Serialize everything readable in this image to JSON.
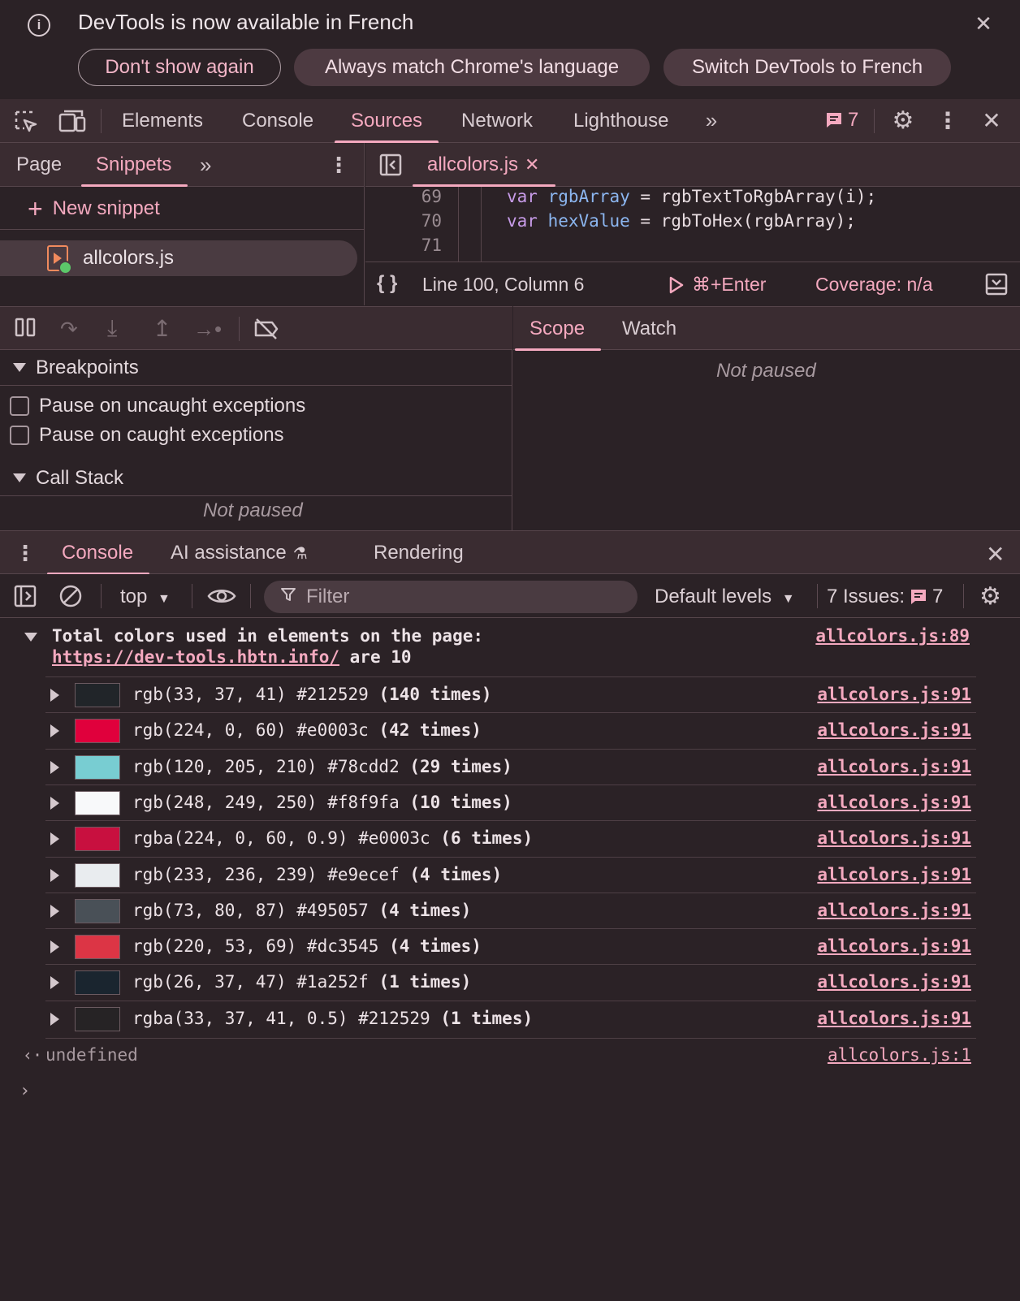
{
  "infobar": {
    "message": "DevTools is now available in French",
    "buttons": [
      "Don't show again",
      "Always match Chrome's language",
      "Switch DevTools to French"
    ]
  },
  "main_tabs": [
    "Elements",
    "Console",
    "Sources",
    "Network",
    "Lighthouse"
  ],
  "active_main_tab": "Sources",
  "issues_badge_count": "7",
  "left_tabs": [
    "Page",
    "Snippets"
  ],
  "active_left_tab": "Snippets",
  "new_snippet_label": "New snippet",
  "snippet_file": "allcolors.js",
  "editor": {
    "tab_name": "allcolors.js",
    "lines": [
      {
        "num": "69",
        "keyword": "var",
        "variable": "rgbArray",
        "rest": " = rgbTextToRgbArray(i);"
      },
      {
        "num": "70",
        "keyword": "var",
        "variable": "hexValue",
        "rest": " = rgbToHex(rgbArray);"
      },
      {
        "num": "71",
        "keyword": "",
        "variable": "",
        "rest": ""
      }
    ],
    "position": "Line 100, Column 6",
    "run_shortcut": "⌘+Enter",
    "coverage": "Coverage: n/a"
  },
  "debugger": {
    "breakpoints_title": "Breakpoints",
    "pause_uncaught": "Pause on uncaught exceptions",
    "pause_caught": "Pause on caught exceptions",
    "callstack_title": "Call Stack",
    "not_paused": "Not paused",
    "scope_tabs": [
      "Scope",
      "Watch"
    ],
    "scope_not_paused": "Not paused"
  },
  "drawer_tabs": [
    "Console",
    "AI assistance",
    "Rendering"
  ],
  "console_toolbar": {
    "context": "top",
    "filter_placeholder": "Filter",
    "levels": "Default levels",
    "issues_label": "7 Issues:",
    "issues_count": "7"
  },
  "console": {
    "group_line1": "Total colors used in elements on the page:",
    "group_url": "https://dev-tools.hbtn.info/",
    "group_suffix": " are 10",
    "group_source": "allcolors.js:89",
    "rows": [
      {
        "color": "#212529",
        "value": "rgb(33, 37, 41) #212529",
        "count": "(140 times)",
        "source": "allcolors.js:91"
      },
      {
        "color": "#e0003c",
        "value": "rgb(224, 0, 60) #e0003c",
        "count": "(42 times)",
        "source": "allcolors.js:91"
      },
      {
        "color": "#78cdd2",
        "value": "rgb(120, 205, 210) #78cdd2",
        "count": "(29 times)",
        "source": "allcolors.js:91"
      },
      {
        "color": "#f8f9fa",
        "value": "rgb(248, 249, 250) #f8f9fa",
        "count": "(10 times)",
        "source": "allcolors.js:91"
      },
      {
        "color": "#c8103f",
        "value": "rgba(224, 0, 60, 0.9) #e0003c",
        "count": "(6 times)",
        "source": "allcolors.js:91"
      },
      {
        "color": "#e9ecef",
        "value": "rgb(233, 236, 239) #e9ecef",
        "count": "(4 times)",
        "source": "allcolors.js:91"
      },
      {
        "color": "#495057",
        "value": "rgb(73, 80, 87) #495057",
        "count": "(4 times)",
        "source": "allcolors.js:91"
      },
      {
        "color": "#dc3545",
        "value": "rgb(220, 53, 69) #dc3545",
        "count": "(4 times)",
        "source": "allcolors.js:91"
      },
      {
        "color": "#1a252f",
        "value": "rgb(26, 37, 47) #1a252f",
        "count": "(1 times)",
        "source": "allcolors.js:91"
      },
      {
        "color": "#262325",
        "value": "rgba(33, 37, 41, 0.5) #212529",
        "count": "(1 times)",
        "source": "allcolors.js:91"
      }
    ],
    "result_value": "undefined",
    "result_source": "allcolors.js:1"
  },
  "colors": {
    "accent": "#f4a9bf",
    "background": "#2b2226",
    "toolbar": "#3a2c31"
  }
}
